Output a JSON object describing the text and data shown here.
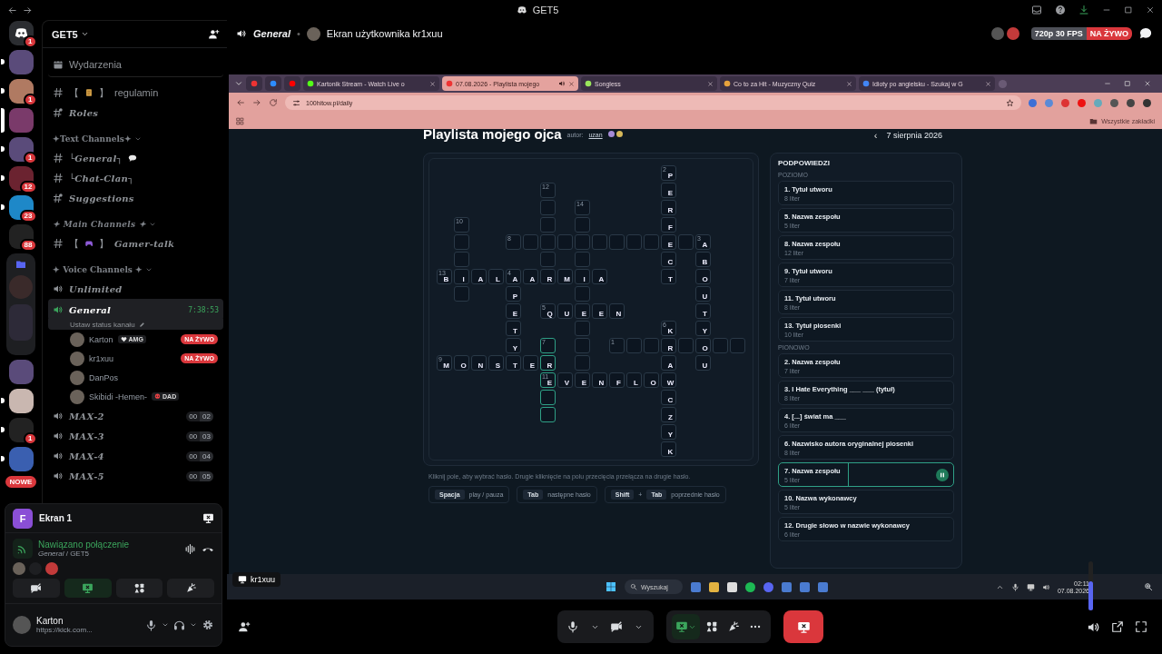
{
  "window": {
    "title": "GET5"
  },
  "server_rail": {
    "items": [
      {
        "kind": "home",
        "badge": "1",
        "selected": false
      },
      {
        "kind": "server",
        "unread": true,
        "selected": false
      },
      {
        "kind": "server",
        "badge": "1",
        "unread": true,
        "selected": false
      },
      {
        "kind": "server",
        "selected": true
      },
      {
        "kind": "server",
        "badge": "1",
        "unread": true,
        "selected": false
      },
      {
        "kind": "server",
        "badge": "12",
        "unread": true,
        "selected": false
      },
      {
        "kind": "server",
        "badge": "23",
        "unread": true,
        "selected": false
      },
      {
        "kind": "server",
        "badge": "88",
        "selected": false
      },
      {
        "kind": "folder",
        "selected": false
      },
      {
        "kind": "server",
        "selected": false
      },
      {
        "kind": "server",
        "unread": true,
        "selected": false
      },
      {
        "kind": "server",
        "badge": "1",
        "unread": true,
        "selected": false
      },
      {
        "kind": "server",
        "unread": true,
        "selected": false,
        "new_label": "NOWE"
      }
    ]
  },
  "sidebar": {
    "server_name": "GET5",
    "items": [
      {
        "kind": "events",
        "name": "Wydarzenia",
        "italic": false
      },
      {
        "kind": "text",
        "open": "【",
        "emoji": {
          "kind": "scroll"
        },
        "close": "】",
        "name": "regulamin",
        "italic": false
      },
      {
        "kind": "rules",
        "name": "Roles",
        "italic": true
      },
      {
        "kind": "category",
        "name": "✦Text Channels✦",
        "italic": false,
        "expanded": true
      },
      {
        "kind": "text",
        "name": "└General┐",
        "italic": true,
        "chat_bubble": true
      },
      {
        "kind": "text",
        "name": "└Chat-Clan┐",
        "italic": true
      },
      {
        "kind": "rules",
        "name": "Suggestions",
        "italic": true
      },
      {
        "kind": "category",
        "name": "✦ Main Channels ✦",
        "italic": true,
        "expanded": true
      },
      {
        "kind": "text",
        "open": "【",
        "emoji": {
          "kind": "gamepad"
        },
        "close": "】",
        "name": "Gamer-talk",
        "italic": true
      },
      {
        "kind": "category",
        "name": "✦ Voice Channels ✦",
        "italic": false,
        "expanded": true
      },
      {
        "kind": "voice",
        "name": "Unlimited",
        "italic": true,
        "selected": false
      },
      {
        "kind": "voice",
        "name": "General",
        "italic": true,
        "selected": true,
        "timer": "7:38:53",
        "status": "Ustaw status kanału",
        "users": [
          {
            "name": "Karton",
            "tag": "AMG",
            "tag_icon": {
              "kind": "heart"
            },
            "live": "NA ŻYWO"
          },
          {
            "name": "kr1xuu",
            "live": "NA ŻYWO"
          },
          {
            "name": "DanPos"
          },
          {
            "name": "Skibidi -Hemen-",
            "tag": "DAD",
            "tag_icon": {
              "kind": "skull"
            }
          }
        ]
      },
      {
        "kind": "voice",
        "name": "MAX-2",
        "italic": true,
        "selected": false,
        "counts": [
          "00",
          "02"
        ]
      },
      {
        "kind": "voice",
        "name": "MAX-3",
        "italic": true,
        "selected": false,
        "counts": [
          "00",
          "03"
        ]
      },
      {
        "kind": "voice",
        "name": "MAX-4",
        "italic": true,
        "selected": false,
        "counts": [
          "00",
          "04"
        ]
      },
      {
        "kind": "voice",
        "name": "MAX-5",
        "italic": true,
        "selected": false,
        "counts": [
          "00",
          "05"
        ]
      }
    ]
  },
  "voice_panel": {
    "stream_title": "Ekran 1",
    "avatar_letter": "F",
    "status": "Nawiązano połączenie",
    "location": "*General* / GET5",
    "buttons": [
      {
        "kind": "camera",
        "on": false
      },
      {
        "kind": "screen",
        "on": true
      },
      {
        "kind": "activity",
        "on": false
      },
      {
        "kind": "soundboard",
        "on": false
      }
    ],
    "user": {
      "name": "Karton",
      "status": "https://kick.com..."
    }
  },
  "header": {
    "channel": "General",
    "separator": "•",
    "title": "Ekran użytkownika kr1xuu",
    "quality": "720p 30 FPS",
    "live": "NA ŻYWO"
  },
  "browser": {
    "tabs": [
      {
        "kind": "pinned",
        "selected": false
      },
      {
        "kind": "pinned",
        "selected": false
      },
      {
        "kind": "pinned",
        "selected": false
      },
      {
        "kind": "page",
        "title": "Kartonik Stream - Watch Live o",
        "selected": false
      },
      {
        "kind": "page",
        "title": "07.08.2026 - Playlista mojego",
        "selected": true,
        "audio": true
      },
      {
        "kind": "page",
        "title": "Songless",
        "selected": false
      },
      {
        "kind": "page",
        "title": "Co to za Hit - Muzyczny Quiz",
        "selected": false
      },
      {
        "kind": "page",
        "title": "Idioty po angielsku - Szukaj w G",
        "selected": false
      }
    ],
    "url": "100hitow.pl/daily",
    "bookmarks_folder": "Wszystkie zakładki"
  },
  "page": {
    "title": "Playlista mojego ojca",
    "author_label": "autor:",
    "author": "uzan",
    "prev": "‹",
    "date": "7 sierpnia 2026",
    "crossword": {
      "rows": [
        [
          null,
          null,
          null,
          null,
          null,
          null,
          null,
          null,
          null,
          null,
          null,
          null,
          null,
          {
            "letter": "P",
            "number": "2",
            "selected": false
          }
        ],
        [
          null,
          null,
          null,
          null,
          null,
          null,
          {
            "number": "12",
            "selected": false
          },
          null,
          null,
          null,
          null,
          null,
          null,
          {
            "letter": "E",
            "selected": false
          }
        ],
        [
          null,
          null,
          null,
          null,
          null,
          null,
          {
            "selected": false
          },
          null,
          {
            "number": "14",
            "selected": false
          },
          null,
          null,
          null,
          null,
          {
            "letter": "R",
            "selected": false
          }
        ],
        [
          null,
          {
            "number": "10",
            "selected": false
          },
          null,
          null,
          null,
          null,
          {
            "selected": false
          },
          null,
          {
            "selected": false
          },
          null,
          null,
          null,
          null,
          {
            "letter": "F",
            "selected": false
          }
        ],
        [
          null,
          {
            "selected": false
          },
          null,
          null,
          {
            "number": "8",
            "selected": false
          },
          {
            "selected": false
          },
          {
            "selected": false
          },
          {
            "selected": false
          },
          {
            "selected": false
          },
          {
            "selected": false
          },
          {
            "selected": false
          },
          {
            "selected": false
          },
          {
            "selected": false
          },
          {
            "letter": "E",
            "selected": false
          },
          {
            "selected": false
          },
          {
            "letter": "A",
            "number": "3",
            "selected": false
          }
        ],
        [
          null,
          {
            "selected": false
          },
          null,
          null,
          null,
          null,
          {
            "selected": false
          },
          null,
          {
            "selected": false
          },
          null,
          null,
          null,
          null,
          {
            "letter": "C",
            "selected": false
          },
          null,
          {
            "letter": "B",
            "selected": false
          }
        ],
        [
          {
            "letter": "B",
            "number": "13",
            "selected": false
          },
          {
            "letter": "I",
            "selected": false
          },
          {
            "letter": "A",
            "selected": false
          },
          {
            "letter": "L",
            "selected": false
          },
          {
            "letter": "A",
            "number": "4",
            "selected": false
          },
          {
            "letter": "A",
            "selected": false
          },
          {
            "letter": "R",
            "selected": false
          },
          {
            "letter": "M",
            "selected": false
          },
          {
            "letter": "I",
            "selected": false
          },
          {
            "letter": "A",
            "selected": false
          },
          null,
          null,
          null,
          {
            "letter": "T",
            "selected": false
          },
          null,
          {
            "letter": "O",
            "selected": false
          }
        ],
        [
          null,
          {
            "selected": false
          },
          null,
          null,
          {
            "letter": "P",
            "selected": false
          },
          null,
          null,
          null,
          {
            "selected": false
          },
          null,
          null,
          null,
          null,
          null,
          null,
          {
            "letter": "U",
            "selected": false
          }
        ],
        [
          null,
          null,
          null,
          null,
          {
            "letter": "E",
            "selected": false
          },
          null,
          {
            "letter": "Q",
            "number": "5",
            "selected": false
          },
          {
            "letter": "U",
            "selected": false
          },
          {
            "letter": "E",
            "selected": false
          },
          {
            "letter": "E",
            "selected": false
          },
          {
            "letter": "N",
            "selected": false
          },
          null,
          null,
          null,
          null,
          {
            "letter": "T",
            "selected": false
          }
        ],
        [
          null,
          null,
          null,
          null,
          {
            "letter": "T",
            "selected": false
          },
          null,
          null,
          null,
          {
            "selected": false
          },
          null,
          null,
          null,
          null,
          {
            "letter": "K",
            "number": "6",
            "selected": false
          },
          null,
          {
            "letter": "Y",
            "selected": false
          }
        ],
        [
          null,
          null,
          null,
          null,
          {
            "letter": "Y",
            "selected": false
          },
          null,
          {
            "number": "7",
            "selected": true
          },
          null,
          {
            "selected": false
          },
          null,
          {
            "number": "1",
            "selected": false
          },
          {
            "selected": false
          },
          {
            "selected": false
          },
          {
            "letter": "R",
            "selected": false
          },
          {
            "selected": false
          },
          {
            "letter": "O",
            "selected": false
          },
          {
            "selected": false
          },
          {
            "selected": false
          }
        ],
        [
          {
            "letter": "M",
            "number": "9",
            "selected": false
          },
          {
            "letter": "O",
            "selected": false
          },
          {
            "letter": "N",
            "selected": false
          },
          {
            "letter": "S",
            "selected": false
          },
          {
            "letter": "T",
            "selected": false
          },
          {
            "letter": "E",
            "selected": false
          },
          {
            "letter": "R",
            "selected": true
          },
          null,
          {
            "selected": false
          },
          null,
          null,
          null,
          null,
          {
            "letter": "A",
            "selected": false
          },
          null,
          {
            "letter": "U",
            "selected": false
          }
        ],
        [
          null,
          null,
          null,
          null,
          null,
          null,
          {
            "letter": "E",
            "number": "11",
            "selected": true
          },
          {
            "letter": "V",
            "selected": false
          },
          {
            "letter": "E",
            "selected": false
          },
          {
            "letter": "N",
            "selected": false
          },
          {
            "letter": "F",
            "selected": false
          },
          {
            "letter": "L",
            "selected": false
          },
          {
            "letter": "O",
            "selected": false
          },
          {
            "letter": "W",
            "selected": false
          }
        ],
        [
          null,
          null,
          null,
          null,
          null,
          null,
          {
            "selected": true
          },
          null,
          null,
          null,
          null,
          null,
          null,
          {
            "letter": "C",
            "selected": false
          }
        ],
        [
          null,
          null,
          null,
          null,
          null,
          null,
          {
            "selected": true
          },
          null,
          null,
          null,
          null,
          null,
          null,
          {
            "letter": "Z",
            "selected": false
          }
        ],
        [
          null,
          null,
          null,
          null,
          null,
          null,
          null,
          null,
          null,
          null,
          null,
          null,
          null,
          {
            "letter": "Y",
            "selected": false
          }
        ],
        [
          null,
          null,
          null,
          null,
          null,
          null,
          null,
          null,
          null,
          null,
          null,
          null,
          null,
          {
            "letter": "K",
            "selected": false
          }
        ]
      ]
    },
    "help": "Kliknij pole, aby wybrać hasło. Drugie kliknięcie na polu przecięcia przełącza na drugie hasło.",
    "shortcuts": [
      {
        "keys": [
          "Spacja"
        ],
        "action": "play / pauza"
      },
      {
        "keys": [
          "Tab"
        ],
        "action": "następne hasło"
      },
      {
        "keys": [
          "Shift",
          "Tab"
        ],
        "plus": "+",
        "action": "poprzednie hasło"
      }
    ],
    "hints": {
      "title": "PODPOWIEDZI",
      "sections": [
        {
          "name": "POZIOMO",
          "clues": [
            {
              "label": "1. Tytuł utworu",
              "length": "8 liter",
              "selected": false
            },
            {
              "label": "5. Nazwa zespołu",
              "length": "5 liter",
              "selected": false
            },
            {
              "label": "8. Nazwa zespołu",
              "length": "12 liter",
              "selected": false
            },
            {
              "label": "9. Tytuł utworu",
              "length": "7 liter",
              "selected": false
            },
            {
              "label": "11. Tytuł utworu",
              "length": "8 liter",
              "selected": false
            },
            {
              "label": "13. Tytuł piosenki",
              "length": "10 liter",
              "selected": false
            }
          ]
        },
        {
          "name": "PIONOWO",
          "clues": [
            {
              "label": "2. Nazwa zespołu",
              "length": "7 liter",
              "selected": false
            },
            {
              "label": "3. I Hate Everything ___ ___ (tytuł)",
              "length": "8 liter",
              "selected": false
            },
            {
              "label": "4. [...] świat ma ___",
              "length": "6 liter",
              "selected": false
            },
            {
              "label": "6. Nazwisko autora oryginalnej piosenki",
              "length": "8 liter",
              "selected": false
            },
            {
              "label": "7. Nazwa zespołu",
              "length": "5 liter",
              "selected": true
            },
            {
              "label": "10. Nazwa wykonawcy",
              "length": "5 liter",
              "selected": false
            },
            {
              "label": "12. Drugie słowo w nazwie wykonawcy",
              "length": "6 liter",
              "selected": false
            }
          ]
        }
      ]
    }
  },
  "taskbar": {
    "stream_label": "kr1xuu",
    "search": "Wyszukaj",
    "time": "02:11",
    "date": "07.08.2026"
  },
  "controls": {
    "volume": {
      "level": 0.6
    }
  }
}
